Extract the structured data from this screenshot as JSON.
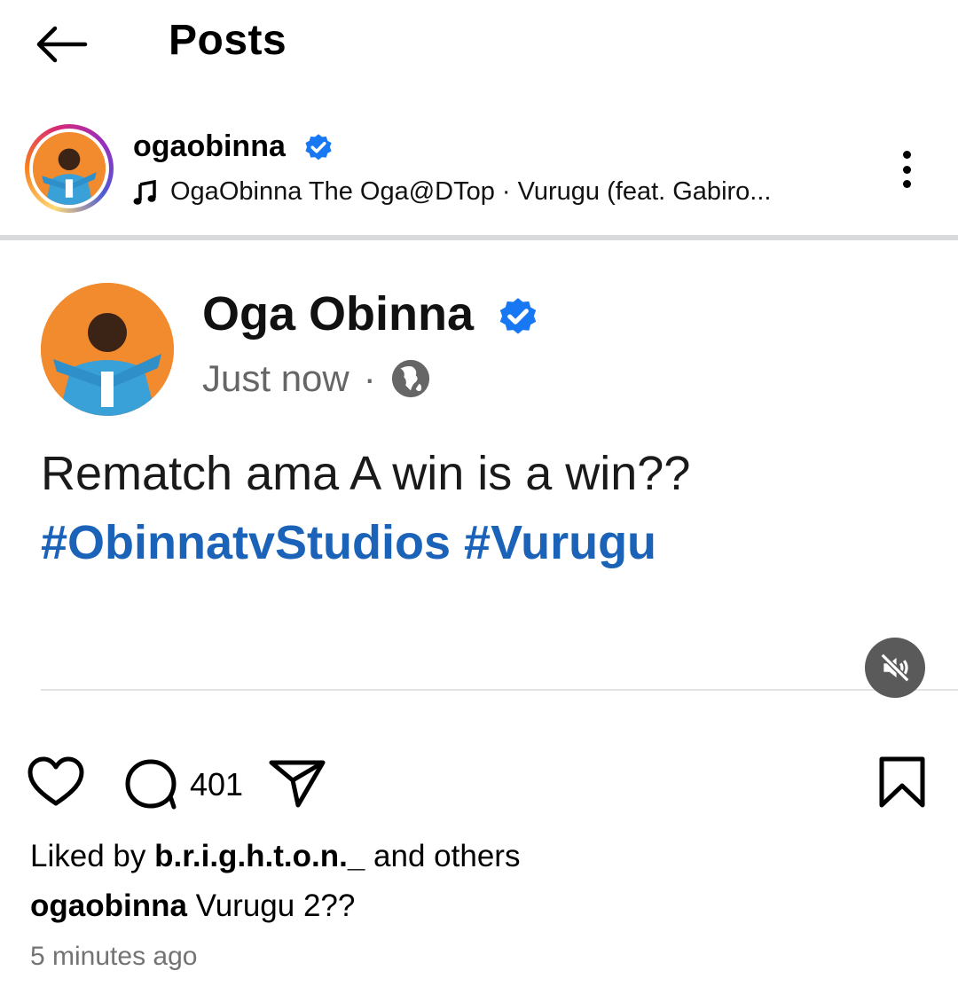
{
  "header": {
    "title": "Posts",
    "back_icon": "arrow-left-icon"
  },
  "post": {
    "username": "ogaobinna",
    "verified": true,
    "music": "OgaObinna The Oga@DTop · Vurugu (feat. Gabiro...",
    "more_icon": "more-vertical-icon"
  },
  "media": {
    "fb_name": "Oga Obinna",
    "fb_time": "Just now",
    "fb_separator": "·",
    "fb_text": "Rematch ama A win is a win??",
    "fb_hashtags": "#ObinnatvStudios #Vurugu",
    "mute_icon": "volume-muted-icon"
  },
  "actions": {
    "comment_count": "401"
  },
  "likes": {
    "prefix": "Liked by ",
    "user": "b.r.i.g.h.t.o.n._",
    "suffix": " and others"
  },
  "caption": {
    "username": "ogaobinna",
    "text": " Vurugu 2??"
  },
  "time_ago": "5 minutes ago",
  "colors": {
    "verified_blue": "#1877f2",
    "hashtag_blue": "#1b63b8",
    "avatar_orange": "#f28a2e"
  }
}
